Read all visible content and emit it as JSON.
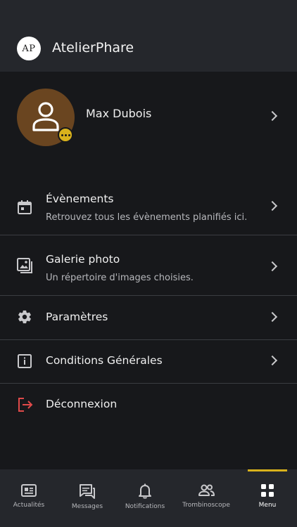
{
  "header": {
    "logo_text": "AP",
    "app_title": "AtelierPhare"
  },
  "profile": {
    "name": "Max Dubois",
    "avatar_icon": "person-icon",
    "badge_icon": "more-dots-icon",
    "avatar_color": "#6a4520",
    "badge_color": "#d9b21c"
  },
  "menu": {
    "items": [
      {
        "title": "Évènements",
        "subtitle": "Retrouvez tous les évènements planifiés ici.",
        "icon": "calendar-icon"
      },
      {
        "title": "Galerie photo",
        "subtitle": "Un répertoire d'images choisies.",
        "icon": "photo-gallery-icon"
      },
      {
        "title": "Paramètres",
        "icon": "gear-icon"
      },
      {
        "title": "Conditions Générales",
        "icon": "info-icon"
      },
      {
        "title": "Déconnexion",
        "icon": "logout-icon",
        "color": "#e04a4a"
      }
    ]
  },
  "nav": {
    "items": [
      {
        "label": "Actualités",
        "icon": "news-icon"
      },
      {
        "label": "Messages",
        "icon": "chat-icon"
      },
      {
        "label": "Notifications",
        "icon": "bell-icon"
      },
      {
        "label": "Trombinoscope",
        "icon": "people-icon"
      },
      {
        "label": "Menu",
        "icon": "grid-icon",
        "active": true
      }
    ],
    "accent": "#d9b21c"
  }
}
